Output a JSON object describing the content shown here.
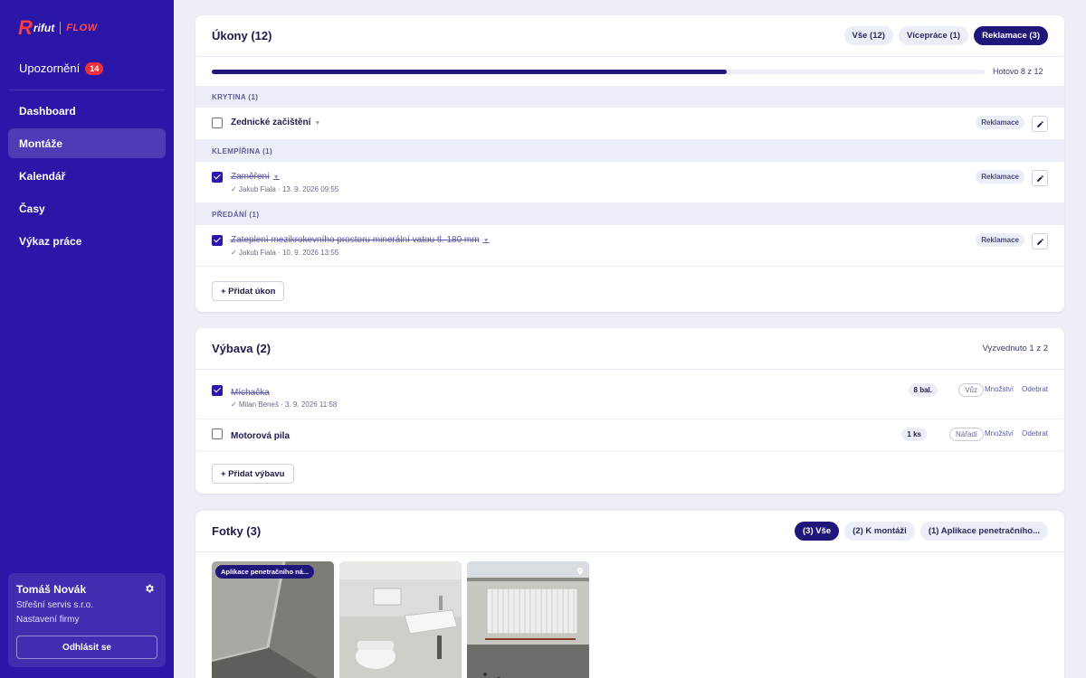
{
  "logo": {
    "mark": "R",
    "brand": "rifut",
    "product": "FLOW"
  },
  "sidebar": {
    "alerts": {
      "label": "Upozornění",
      "count": "14"
    },
    "nav": [
      {
        "label": "Dashboard"
      },
      {
        "label": "Montáže"
      },
      {
        "label": "Kalendář"
      },
      {
        "label": "Časy"
      },
      {
        "label": "Výkaz práce"
      }
    ],
    "active_index": 1,
    "user": {
      "name": "Tomáš Novák",
      "company": "Střešní servis s.r.o.",
      "settings": "Nastavení firmy",
      "logout": "Odhlásit se"
    }
  },
  "tasks": {
    "title": "Úkony (12)",
    "filters": [
      {
        "label": "Vše (12)",
        "active": false
      },
      {
        "label": "Vícepráce (1)",
        "active": false
      },
      {
        "label": "Reklamace (3)",
        "active": true
      }
    ],
    "progress": {
      "done": 8,
      "total": 12,
      "label": "Hotovo 8 z 12"
    },
    "groups": [
      {
        "name": "KRYTINA (1)",
        "items": [
          {
            "name": "Zednické začištění",
            "done": false,
            "meta": "",
            "tag": "Reklamace"
          }
        ]
      },
      {
        "name": "KLEMPÍŘINA (1)",
        "items": [
          {
            "name": "Zaměření",
            "done": true,
            "meta": "✓ Jakub Fiala · 13. 9. 2026 09:55",
            "tag": "Reklamace"
          }
        ]
      },
      {
        "name": "PŘEDÁNÍ (1)",
        "items": [
          {
            "name": "Zateplení mezikrokevního prostoru minerální vatou tl. 180 mm",
            "done": true,
            "meta": "✓ Jakub Fiala · 10. 9. 2026 13:55",
            "tag": "Reklamace"
          }
        ]
      }
    ],
    "add_label": "+ Přidat úkon"
  },
  "equipment": {
    "title": "Výbava (2)",
    "status": "Vyzvednuto 1 z 2",
    "items": [
      {
        "name": "Míchačka",
        "done": true,
        "meta": "✓ Milan Beneš · 3. 9. 2026 11:58",
        "qty": "8 bal.",
        "location": "Vůz",
        "qty_link": "Množství",
        "remove_link": "Odebrat"
      },
      {
        "name": "Motorová pila",
        "done": false,
        "meta": "",
        "qty": "1 ks",
        "location": "Nářadí",
        "qty_link": "Množství",
        "remove_link": "Odebrat"
      }
    ],
    "add_label": "+ Přidat výbavu"
  },
  "photos": {
    "title": "Fotky (3)",
    "filters": [
      {
        "label": "(3) Vše",
        "active": true
      },
      {
        "label": "(2) K montáži",
        "active": false
      },
      {
        "label": "(1) Aplikace penetračního...",
        "active": false
      }
    ],
    "items": [
      {
        "caption": "Aplikace penetračního ná...",
        "has_pin": false
      },
      {
        "caption": "",
        "has_pin": false
      },
      {
        "caption": "",
        "has_pin": true
      }
    ]
  }
}
